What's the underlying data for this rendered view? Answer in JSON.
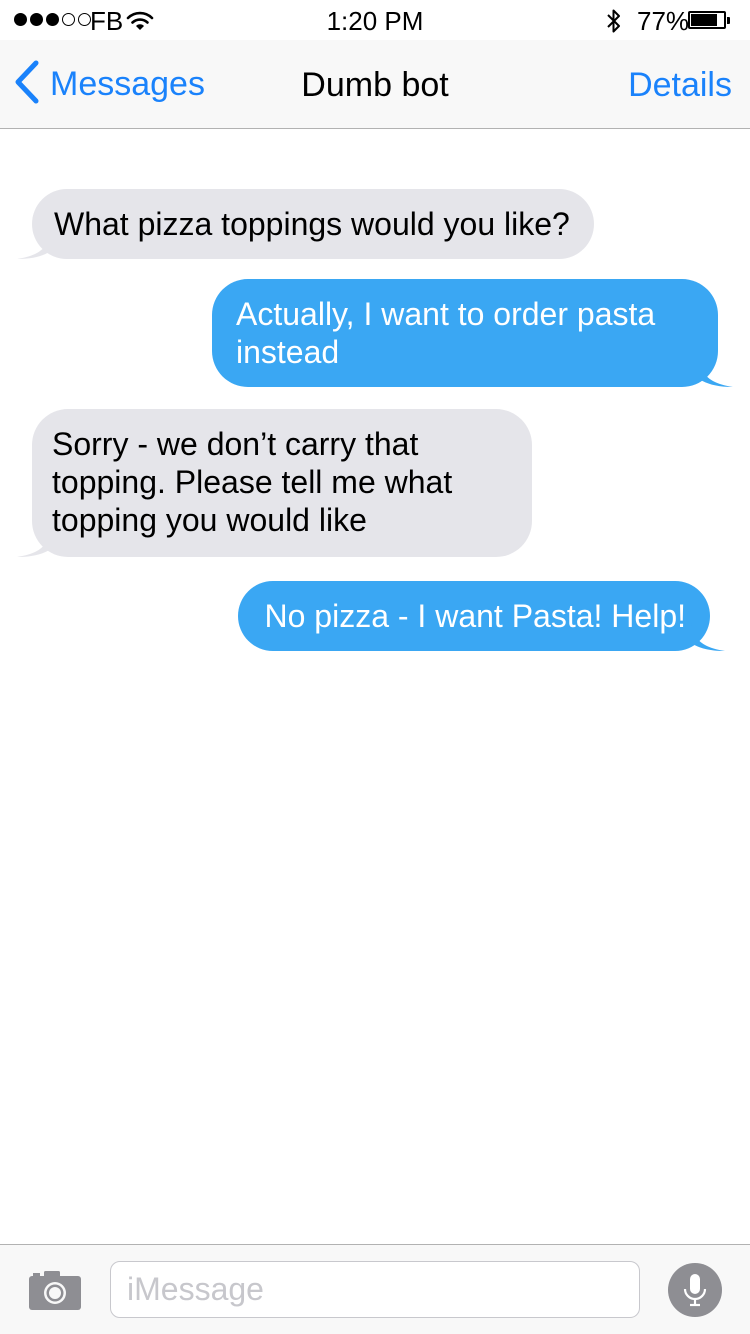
{
  "status_bar": {
    "signal_strength": 3,
    "signal_max": 5,
    "carrier": "FB",
    "time": "1:20 PM",
    "battery_percent": "77%",
    "battery_level": 0.77,
    "icons": [
      "signal-dots-icon",
      "wifi-icon",
      "bluetooth-icon",
      "battery-icon"
    ]
  },
  "nav": {
    "back_label": "Messages",
    "title": "Dumb bot",
    "details_label": "Details",
    "accent_color": "#1a82fb"
  },
  "messages": [
    {
      "direction": "incoming",
      "lines": [
        "What pizza toppings would you like?"
      ]
    },
    {
      "direction": "outgoing",
      "lines": [
        "Actually, I want to order pasta",
        "instead"
      ]
    },
    {
      "direction": "incoming",
      "lines": [
        "Sorry - we don’t carry that",
        "topping. Please tell me what",
        "topping you would like"
      ]
    },
    {
      "direction": "outgoing",
      "lines": [
        "No pizza - I want Pasta! Help!"
      ]
    }
  ],
  "colors": {
    "incoming_bubble": "#e5e5ea",
    "outgoing_bubble": "#3aa7f3"
  },
  "input_bar": {
    "placeholder": "iMessage",
    "value": "",
    "icons": [
      "camera-icon",
      "microphone-icon"
    ]
  }
}
